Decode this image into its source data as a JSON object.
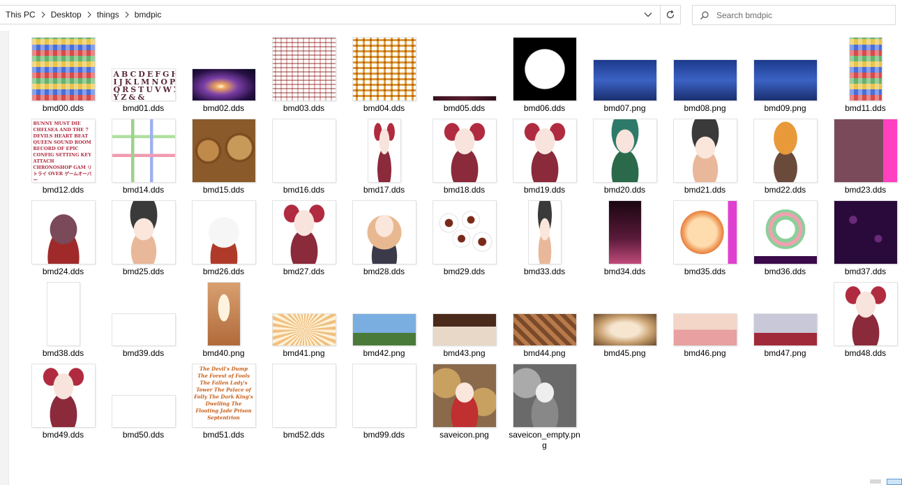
{
  "breadcrumb": [
    "This PC",
    "Desktop",
    "things",
    "bmdpic"
  ],
  "search": {
    "placeholder": "Search bmdpic"
  },
  "files": [
    {
      "name": "bmd00.dds",
      "shape": "sq",
      "fill": "t-sheet"
    },
    {
      "name": "bmd01.dds",
      "shape": "wide",
      "fill": "t-font",
      "text": "ABCDEFGH IJKLMNOP QRSTUVWX YZ&&"
    },
    {
      "name": "bmd02.dds",
      "shape": "wide",
      "fill": "t-nebula"
    },
    {
      "name": "bmd03.dds",
      "shape": "sq",
      "fill": "t-sprites"
    },
    {
      "name": "bmd04.dds",
      "shape": "sq",
      "fill": "t-sprites2"
    },
    {
      "name": "bmd05.dds",
      "shape": "strip",
      "fill": "t-dark"
    },
    {
      "name": "bmd06.dds",
      "shape": "sq",
      "fill": "t-circle"
    },
    {
      "name": "bmd07.png",
      "shape": "med",
      "fill": "t-night"
    },
    {
      "name": "bmd08.png",
      "shape": "med",
      "fill": "t-night"
    },
    {
      "name": "bmd09.png",
      "shape": "med",
      "fill": "t-night"
    },
    {
      "name": "bmd11.dds",
      "shape": "tall",
      "fill": "t-sheet"
    },
    {
      "name": "bmd12.dds",
      "shape": "sq",
      "fill": "t-menu",
      "text": "BUNNY MUST DIE CHELSEA AND THE 7 DEVILS HEART BEAT QUEEN SOUND ROOM RECORD OF EPIC CONFIG SETTING KEY ATTACH CHRONOSHOP GAM リトライ OVER ゲームオーバー"
    },
    {
      "name": "bmd14.dds",
      "shape": "sq",
      "fill": "t-pipes"
    },
    {
      "name": "bmd15.dds",
      "shape": "sq",
      "fill": "t-gears"
    },
    {
      "name": "bmd16.dds",
      "shape": "sq",
      "fill": "t-goldtext"
    },
    {
      "name": "bmd17.dds",
      "shape": "tall",
      "fill": "t-char"
    },
    {
      "name": "bmd18.dds",
      "shape": "sq",
      "fill": "t-char"
    },
    {
      "name": "bmd19.dds",
      "shape": "sq",
      "fill": "t-char"
    },
    {
      "name": "bmd20.dds",
      "shape": "sq",
      "fill": "t-green"
    },
    {
      "name": "bmd21.dds",
      "shape": "sq",
      "fill": "t-maid"
    },
    {
      "name": "bmd22.dds",
      "shape": "sq",
      "fill": "t-pumpkin"
    },
    {
      "name": "bmd23.dds",
      "shape": "sq",
      "fill": "t-cat"
    },
    {
      "name": "bmd24.dds",
      "shape": "sq",
      "fill": "t-villain"
    },
    {
      "name": "bmd25.dds",
      "shape": "sq",
      "fill": "t-maid"
    },
    {
      "name": "bmd26.dds",
      "shape": "sq",
      "fill": "t-whitebunny"
    },
    {
      "name": "bmd27.dds",
      "shape": "sq",
      "fill": "t-char"
    },
    {
      "name": "bmd28.dds",
      "shape": "sq",
      "fill": "t-blonde"
    },
    {
      "name": "bmd29.dds",
      "shape": "sq",
      "fill": "t-eyes"
    },
    {
      "name": "bmd33.dds",
      "shape": "tall",
      "fill": "t-maid"
    },
    {
      "name": "bmd34.dds",
      "shape": "tall",
      "fill": "t-sparkle"
    },
    {
      "name": "bmd35.dds",
      "shape": "sq",
      "fill": "t-moon"
    },
    {
      "name": "bmd36.dds",
      "shape": "sq",
      "fill": "t-wheel"
    },
    {
      "name": "bmd37.dds",
      "shape": "sq",
      "fill": "t-purple"
    },
    {
      "name": "bmd38.dds",
      "shape": "tall",
      "fill": "t-credits"
    },
    {
      "name": "bmd39.dds",
      "shape": "wide",
      "fill": "t-txtstrip"
    },
    {
      "name": "bmd40.png",
      "shape": "tall",
      "fill": "t-sepia"
    },
    {
      "name": "bmd41.png",
      "shape": "wide",
      "fill": "t-rays"
    },
    {
      "name": "bmd42.png",
      "shape": "wide",
      "fill": "t-sky"
    },
    {
      "name": "bmd43.png",
      "shape": "wide",
      "fill": "t-scene"
    },
    {
      "name": "bmd44.png",
      "shape": "wide",
      "fill": "t-brown"
    },
    {
      "name": "bmd45.png",
      "shape": "wide",
      "fill": "t-sepia2"
    },
    {
      "name": "bmd46.png",
      "shape": "wide",
      "fill": "t-crowd"
    },
    {
      "name": "bmd47.png",
      "shape": "wide",
      "fill": "t-room"
    },
    {
      "name": "bmd48.dds",
      "shape": "sq",
      "fill": "t-char"
    },
    {
      "name": "bmd49.dds",
      "shape": "sq",
      "fill": "t-char"
    },
    {
      "name": "bmd50.dds",
      "shape": "wide",
      "fill": "t-txtstrip"
    },
    {
      "name": "bmd51.dds",
      "shape": "sq",
      "fill": "t-goldtext",
      "text": "The Devil's Dump The Forest of Fools The Fallen Lady's Tower The Palace of Folly The Dark King's Dwelling The Floating Jade Prison Septentrion"
    },
    {
      "name": "bmd52.dds",
      "shape": "sq",
      "fill": "t-credits"
    },
    {
      "name": "bmd99.dds",
      "shape": "sq",
      "fill": "t-redsil"
    },
    {
      "name": "saveicon.png",
      "shape": "sq",
      "fill": "t-gearchar"
    },
    {
      "name": "saveicon_empty.png",
      "shape": "sq",
      "fill": "t-gray"
    }
  ]
}
